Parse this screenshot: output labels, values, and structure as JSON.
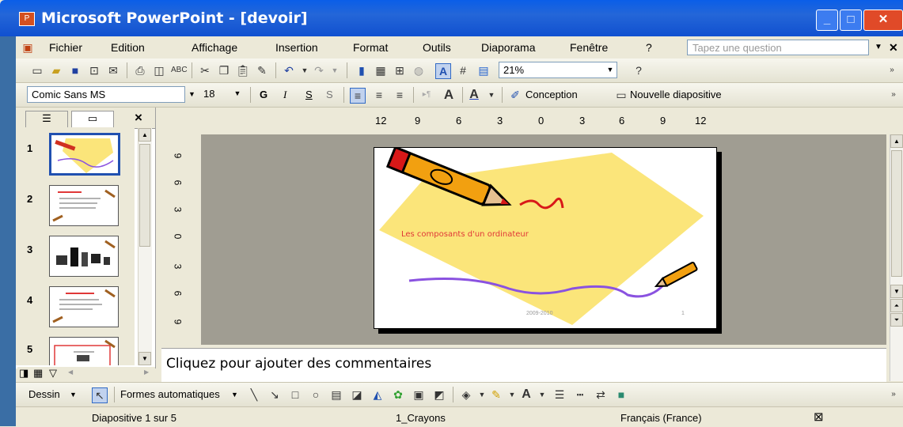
{
  "window": {
    "title": "Microsoft PowerPoint - [devoir]"
  },
  "menu": {
    "items": [
      "Fichier",
      "Edition",
      "Affichage",
      "Insertion",
      "Format",
      "Outils",
      "Diaporama",
      "Fenêtre",
      "?"
    ],
    "question_placeholder": "Tapez une question"
  },
  "standard_toolbar": {
    "zoom": "21%"
  },
  "format_toolbar": {
    "font": "Comic Sans MS",
    "size": "18",
    "bold": "G",
    "italic": "I",
    "underline": "S",
    "shadow": "S",
    "design_label": "Conception",
    "new_slide_label": "Nouvelle diapositive"
  },
  "left_pane": {
    "close": "×",
    "slides": [
      "1",
      "2",
      "3",
      "4",
      "5"
    ],
    "selected": 1
  },
  "rulers": {
    "horizontal": [
      "12",
      "9",
      "6",
      "3",
      "0",
      "3",
      "6",
      "9",
      "12"
    ],
    "vertical": [
      "9",
      "6",
      "3",
      "0",
      "3",
      "6",
      "9"
    ]
  },
  "slide": {
    "title": "Les composants d'un ordinateur",
    "date": "2009-2010",
    "page": "1",
    "colors": {
      "diamond": "#fbe57a",
      "wave": "#8a52e0",
      "title": "#e03838"
    }
  },
  "notes": {
    "placeholder": "Cliquez pour ajouter des commentaires"
  },
  "drawing_toolbar": {
    "draw_label": "Dessin",
    "autoshapes_label": "Formes automatiques"
  },
  "status": {
    "slide_info": "Diapositive 1 sur 5",
    "design": "1_Crayons",
    "language": "Français (France)"
  }
}
